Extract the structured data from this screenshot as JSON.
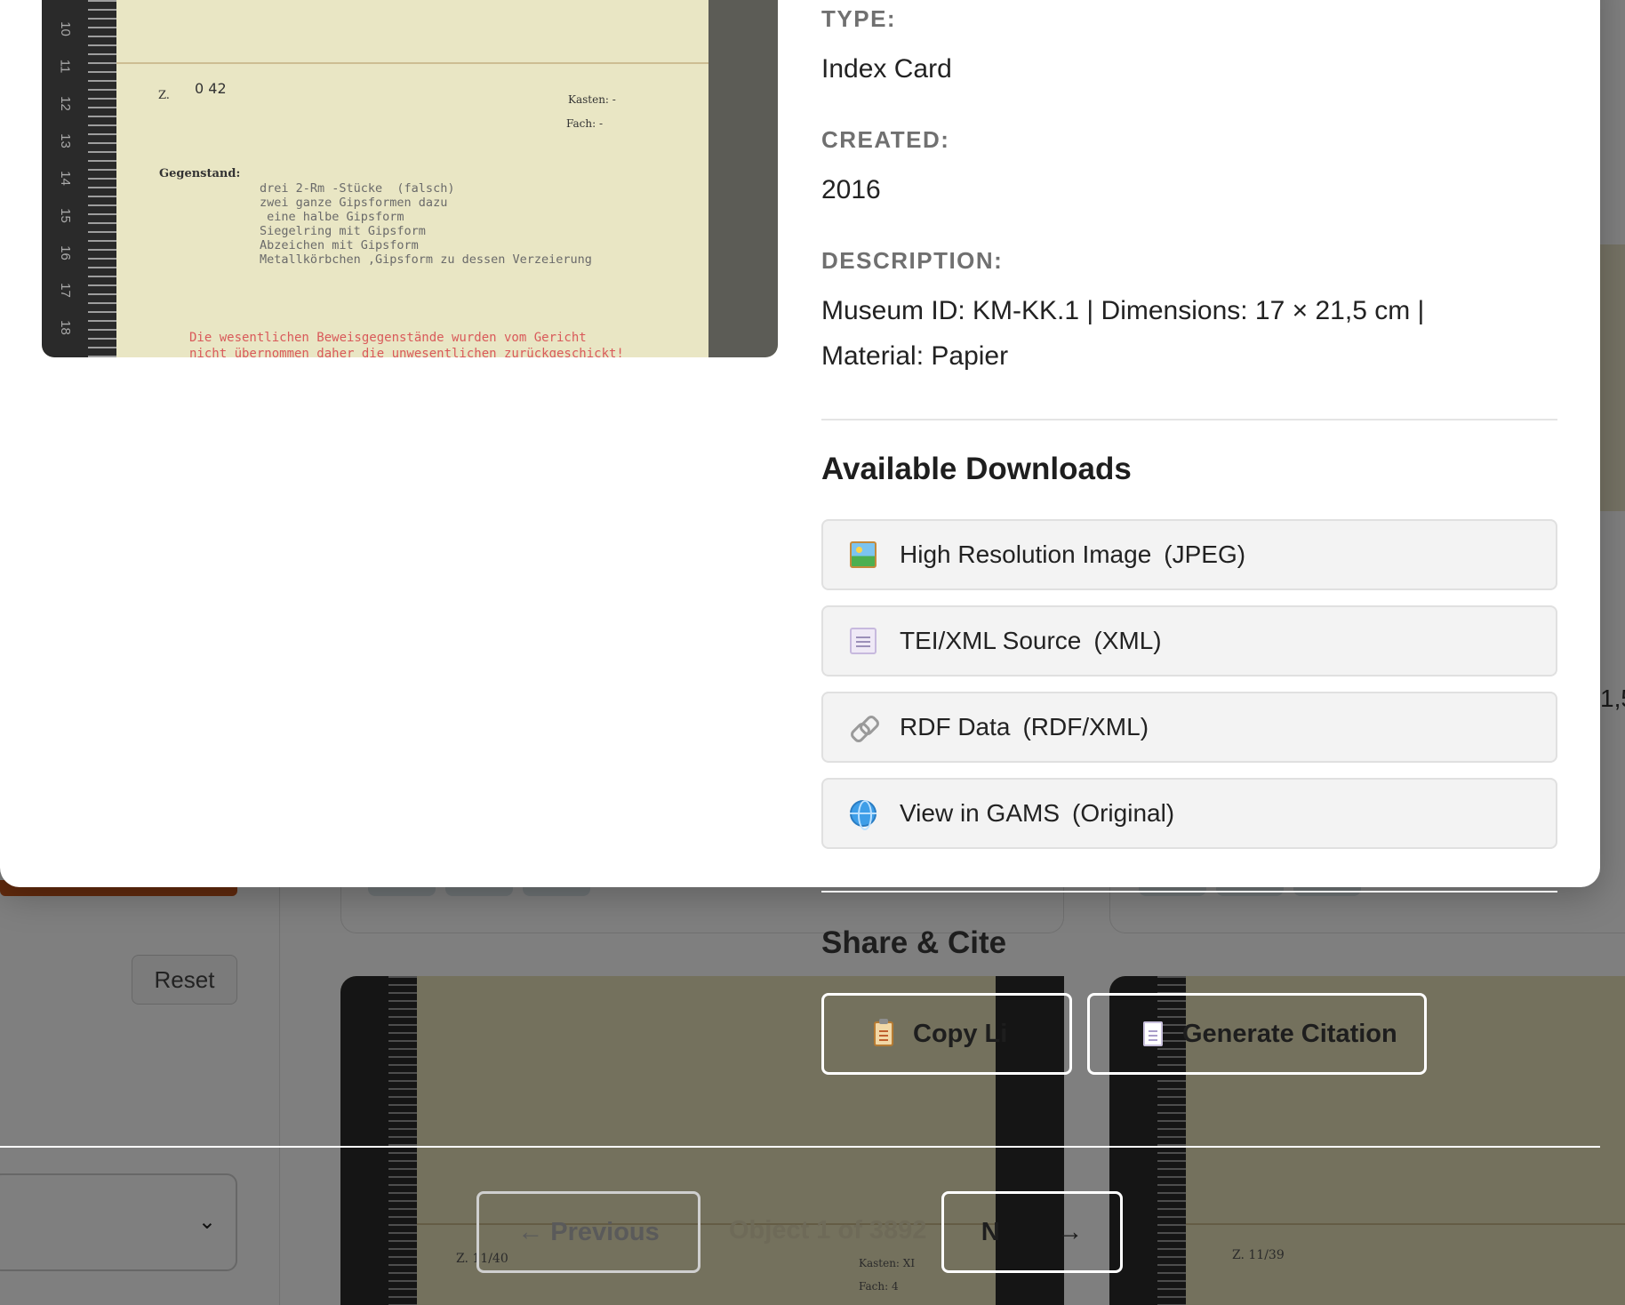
{
  "background": {
    "reset_label": "Reset",
    "select_chevron": "chevron-down-icon",
    "scan_left_text": "Z. 11/40",
    "scan_left_kasten": "Kasten: XI",
    "scan_left_fach": "Fach: 4",
    "scan_right_text": "Z. 11/39",
    "right_edge_char": "1,5"
  },
  "modal": {
    "scan": {
      "z_label": "Z.",
      "z_value": "0 42",
      "kasten": "Kasten: -",
      "fach": "Fach: -",
      "gegenstand_label": "Gegenstand:",
      "items": "drei 2-Rm -Stücke  (falsch)\nzwei ganze Gipsformen dazu\n eine halbe Gipsform\nSiegelring mit Gipsform\nAbzeichen mit Gipsform\nMetallkörbchen ,Gipsform zu dessen Verzeierung",
      "red_line_1": "Die wesentlichen Beweisgegenstände wurden vom Gericht",
      "red_line_2": "nicht übernommen daher die unwesentlichen zurückgeschickt!"
    },
    "type_label": "TYPE:",
    "type_value": "Index Card",
    "created_label": "CREATED:",
    "created_value": "2016",
    "description_label": "DESCRIPTION:",
    "description_line_1": "Museum ID: KM-KK.1 | Dimensions: 17 × 21,5 cm |",
    "description_line_2": "Material: Papier",
    "downloads_title": "Available Downloads",
    "downloads": [
      {
        "icon": "image-icon",
        "label": "High Resolution Image",
        "format": "(JPEG)"
      },
      {
        "icon": "document-icon",
        "label": "TEI/XML Source",
        "format": "(XML)"
      },
      {
        "icon": "link-icon",
        "label": "RDF Data",
        "format": "(RDF/XML)"
      },
      {
        "icon": "globe-icon",
        "label": "View in GAMS",
        "format": "(Original)"
      }
    ],
    "share_title": "Share & Cite",
    "copy_link_label": "Copy Li",
    "generate_citation_label": "Generate Citation",
    "prev_label": "← Previous",
    "counter": "Object 1 of 3892",
    "next_label": "N        →"
  },
  "colors": {
    "accent_orange": "#c4541a",
    "dim_overlay": "rgba(0,0,0,0.5)",
    "paper": "#e9e6c4"
  }
}
